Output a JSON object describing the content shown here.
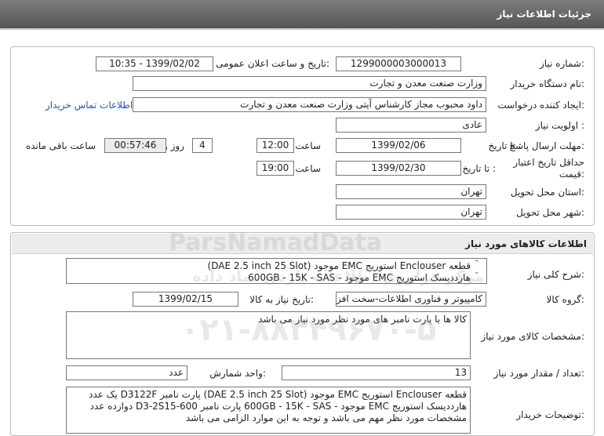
{
  "header": {
    "title": "جزئیات اطلاعات نیاز"
  },
  "need_info": {
    "need_number": {
      "label": "شماره نیاز:",
      "value": "1299000003000013"
    },
    "announce": {
      "label": "تاریخ و ساعت اعلان عمومی:",
      "value": "1399/02/02 - 10:35"
    },
    "buyer_org": {
      "label": "نام دستگاه خریدار:",
      "value": "وزارت صنعت معدن و تجارت"
    },
    "creator": {
      "label": "ایجاد کننده درخواست:",
      "value": "داود محبوب مجاز کارشناس آیتی وزارت صنعت معدن و تجارت"
    },
    "contact_link": "اطلاعات تماس خریدار",
    "priority": {
      "label": "اولویت نیاز :",
      "value": "عادی"
    },
    "reply_deadline": {
      "label": "مهلت ارسال پاسخ:",
      "to_date_label": "تا تاریخ :",
      "date": "1399/02/06",
      "hour_label": "ساعت",
      "time": "12:00",
      "days": "4",
      "days_label": "روز و",
      "remaining": "00:57:46",
      "remaining_label": "ساعت باقی مانده"
    },
    "price_validity": {
      "label": "حداقل تاریخ اعتبار قیمت:",
      "to_date_label": "تا تاریخ :",
      "date": "1399/02/30",
      "hour_label": "ساعت",
      "time": "19:00"
    },
    "delivery_province": {
      "label": "استان محل تحویل:",
      "value": "تهران"
    },
    "delivery_city": {
      "label": "شهر محل تحویل:",
      "value": "تهران"
    }
  },
  "goods": {
    "title": "اطلاعات کالاهای مورد نیاز",
    "summary_label": "شرح کلی نیاز:",
    "summary_lines": [
      "قطعه Enclouser استوریج EMC موجود (DAE 2.5 inch 25 Slot)",
      "هارددیسک استوریج EMC موجود - 600GB - 15K - SAS"
    ],
    "group_label": "گروه کالا:",
    "group_value": "کامپیوتر و فناوری اطلاعات-سخت افزار",
    "need_date_label": "تاریخ نیاز به کالا:",
    "need_date": "1399/02/15",
    "spec_label": "مشخصات کالای مورد نیاز:",
    "spec_value": "کالا ها با پارت نامبر  های مورد نظر مورد نیاز می باشد",
    "qty_label": "تعداد / مقدار مورد نیاز:",
    "qty_value": "13",
    "unit_label": "واحد شمارش:",
    "unit_value": "عدد",
    "buyer_notes_label": "توضیحات خریدار:",
    "buyer_notes_lines": [
      "قطعه Enclouser استوریج EMC موجود (DAE 2.5 inch 25 Slot)      پارت نامبر D3122F یک عدد",
      "هارددیسک استوریج EMC موجود - 600GB - 15K - SAS      پارت نامبر  D3-2S15-600   دوازده عدد",
      "مشخصات مورد نظر مهم می باشد و توجه به این موارد الزامی می باشد"
    ]
  },
  "watermark": {
    "brand": "ParsNamadData",
    "company": "مرکز فراوری اطلاعات پارس نماد داده",
    "phone": "۰۲۱-۸۸۳۴۹۶۷۰-۵"
  }
}
